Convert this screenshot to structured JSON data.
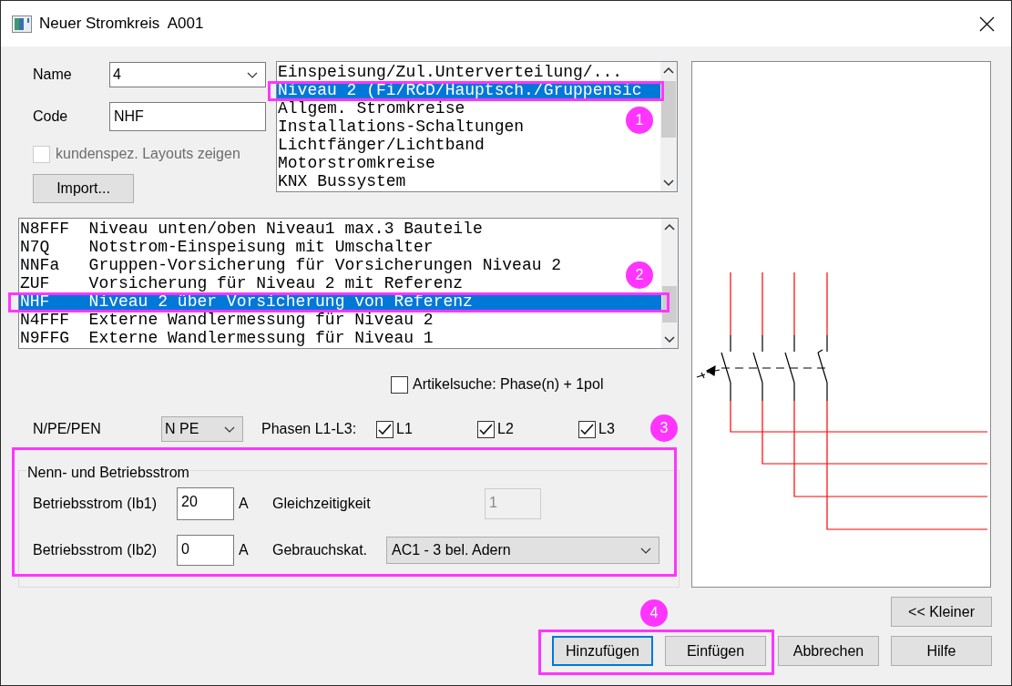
{
  "window": {
    "title": "Neuer Stromkreis  A001"
  },
  "name_field": {
    "label": "Name",
    "value": "4"
  },
  "code_field": {
    "label": "Code",
    "value": "NHF"
  },
  "custom_layouts": {
    "label": "kundenspez. Layouts zeigen",
    "checked": false,
    "disabled": true
  },
  "import_button": {
    "label": "Import..."
  },
  "category_list": {
    "items": [
      {
        "text": "Einspeisung/Zul.Unterverteilung/...",
        "selected": false
      },
      {
        "text": "Niveau 2 (Fi/RCD/Hauptsch./Gruppensic",
        "selected": true
      },
      {
        "text": "Allgem. Stromkreise",
        "selected": false
      },
      {
        "text": "Installations-Schaltungen",
        "selected": false
      },
      {
        "text": "Lichtfänger/Lichtband",
        "selected": false
      },
      {
        "text": "Motorstromkreise",
        "selected": false
      },
      {
        "text": "KNX Bussystem",
        "selected": false
      }
    ]
  },
  "circuit_list": {
    "rows": [
      {
        "code": "N8FFF",
        "description": "Niveau unten/oben Niveau1 max.3 Bauteile",
        "selected": false
      },
      {
        "code": "N7Q",
        "description": "Notstrom-Einspeisung mit Umschalter",
        "selected": false
      },
      {
        "code": "NNFa",
        "description": "Gruppen-Vorsicherung für Vorsicherungen Niveau 2",
        "selected": false
      },
      {
        "code": "ZUF",
        "description": "Vorsicherung für Niveau 2 mit Referenz",
        "selected": false
      },
      {
        "code": "NHF",
        "description": "Niveau 2 über Vorsicherung von Referenz",
        "selected": true
      },
      {
        "code": "N4FFF",
        "description": "Externe Wandlermessung für Niveau 2",
        "selected": false
      },
      {
        "code": "N9FFG",
        "description": "Externe Wandlermessung für Niveau 1",
        "selected": false
      }
    ]
  },
  "article_search": {
    "label": "Artikelsuche: Phase(n) + 1pol",
    "checked": false
  },
  "npe_field": {
    "label": "N/PE/PEN",
    "value": "N PE"
  },
  "phases": {
    "label": "Phasen L1-L3:",
    "items": [
      {
        "label": "L1",
        "checked": true
      },
      {
        "label": "L2",
        "checked": true
      },
      {
        "label": "L3",
        "checked": true
      }
    ]
  },
  "current_group": {
    "title": "Nenn- und Betriebsstrom",
    "ib1": {
      "label": "Betriebsstrom (Ib1)",
      "value": "20",
      "unit": "A"
    },
    "ib2": {
      "label": "Betriebsstrom (Ib2)",
      "value": "0",
      "unit": "A"
    },
    "simultaneity": {
      "label": "Gleichzeitigkeit",
      "value": "1",
      "disabled": true
    },
    "usage_category": {
      "label": "Gebrauchskat.",
      "value": "AC1 - 3 bel. Adern"
    }
  },
  "footer": {
    "upper_buttons": [
      {
        "label": "<< Kleiner",
        "default": false
      }
    ],
    "lower_buttons": [
      {
        "label": "Hinzufügen",
        "default": true
      },
      {
        "label": "Einfügen",
        "default": false
      },
      {
        "label": "Abbrechen",
        "default": false
      },
      {
        "label": "Hilfe",
        "default": false
      }
    ]
  },
  "annotations": [
    {
      "label": "1"
    },
    {
      "label": "2"
    },
    {
      "label": "3"
    },
    {
      "label": "4"
    }
  ]
}
